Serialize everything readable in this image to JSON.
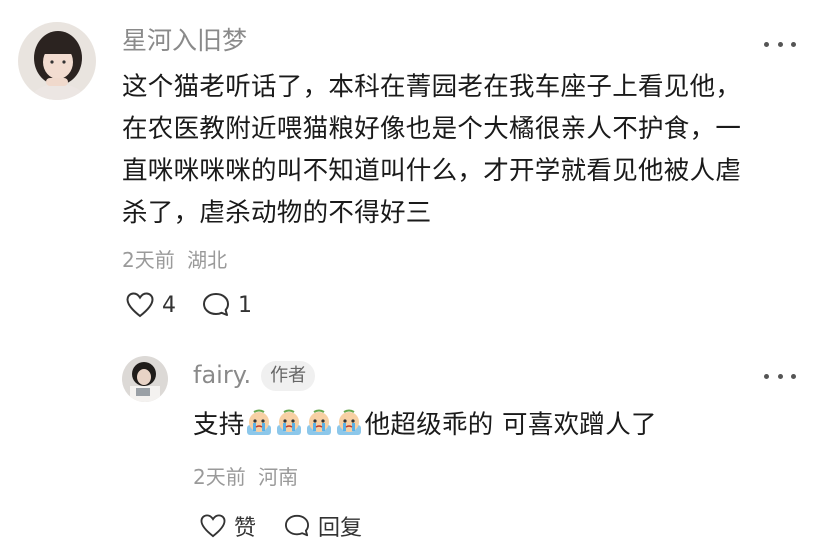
{
  "comment": {
    "username": "星河入旧梦",
    "content_lines": [
      "这个猫老听话了，本科在菁园老在我车座子上看见他，",
      "在农医教附近喂猫粮好像也是个大橘很亲人不护食，一",
      "直咪咪咪咪的叫不知道叫什么，才开学就看见他被人虐",
      "杀了，虐杀动物的不得好三"
    ],
    "time": "2天前",
    "location": "湖北",
    "like_count": "4",
    "reply_count": "1",
    "avatar_icon": "girl-portrait-avatar",
    "more_icon": "ellipsis-icon"
  },
  "reply": {
    "username": "fairy.",
    "badge": "作者",
    "content_prefix": "支持",
    "emoji_count": 4,
    "emoji_name": "crying-face-emoji",
    "content_suffix": "他超级乖的 可喜欢蹭人了",
    "time": "2天前",
    "location": "河南",
    "like_label": "赞",
    "reply_label": "回复",
    "avatar_icon": "person-avatar"
  },
  "colors": {
    "username": "#8a8a8a",
    "meta": "#9a9a9a",
    "text": "#1a1a1a"
  }
}
